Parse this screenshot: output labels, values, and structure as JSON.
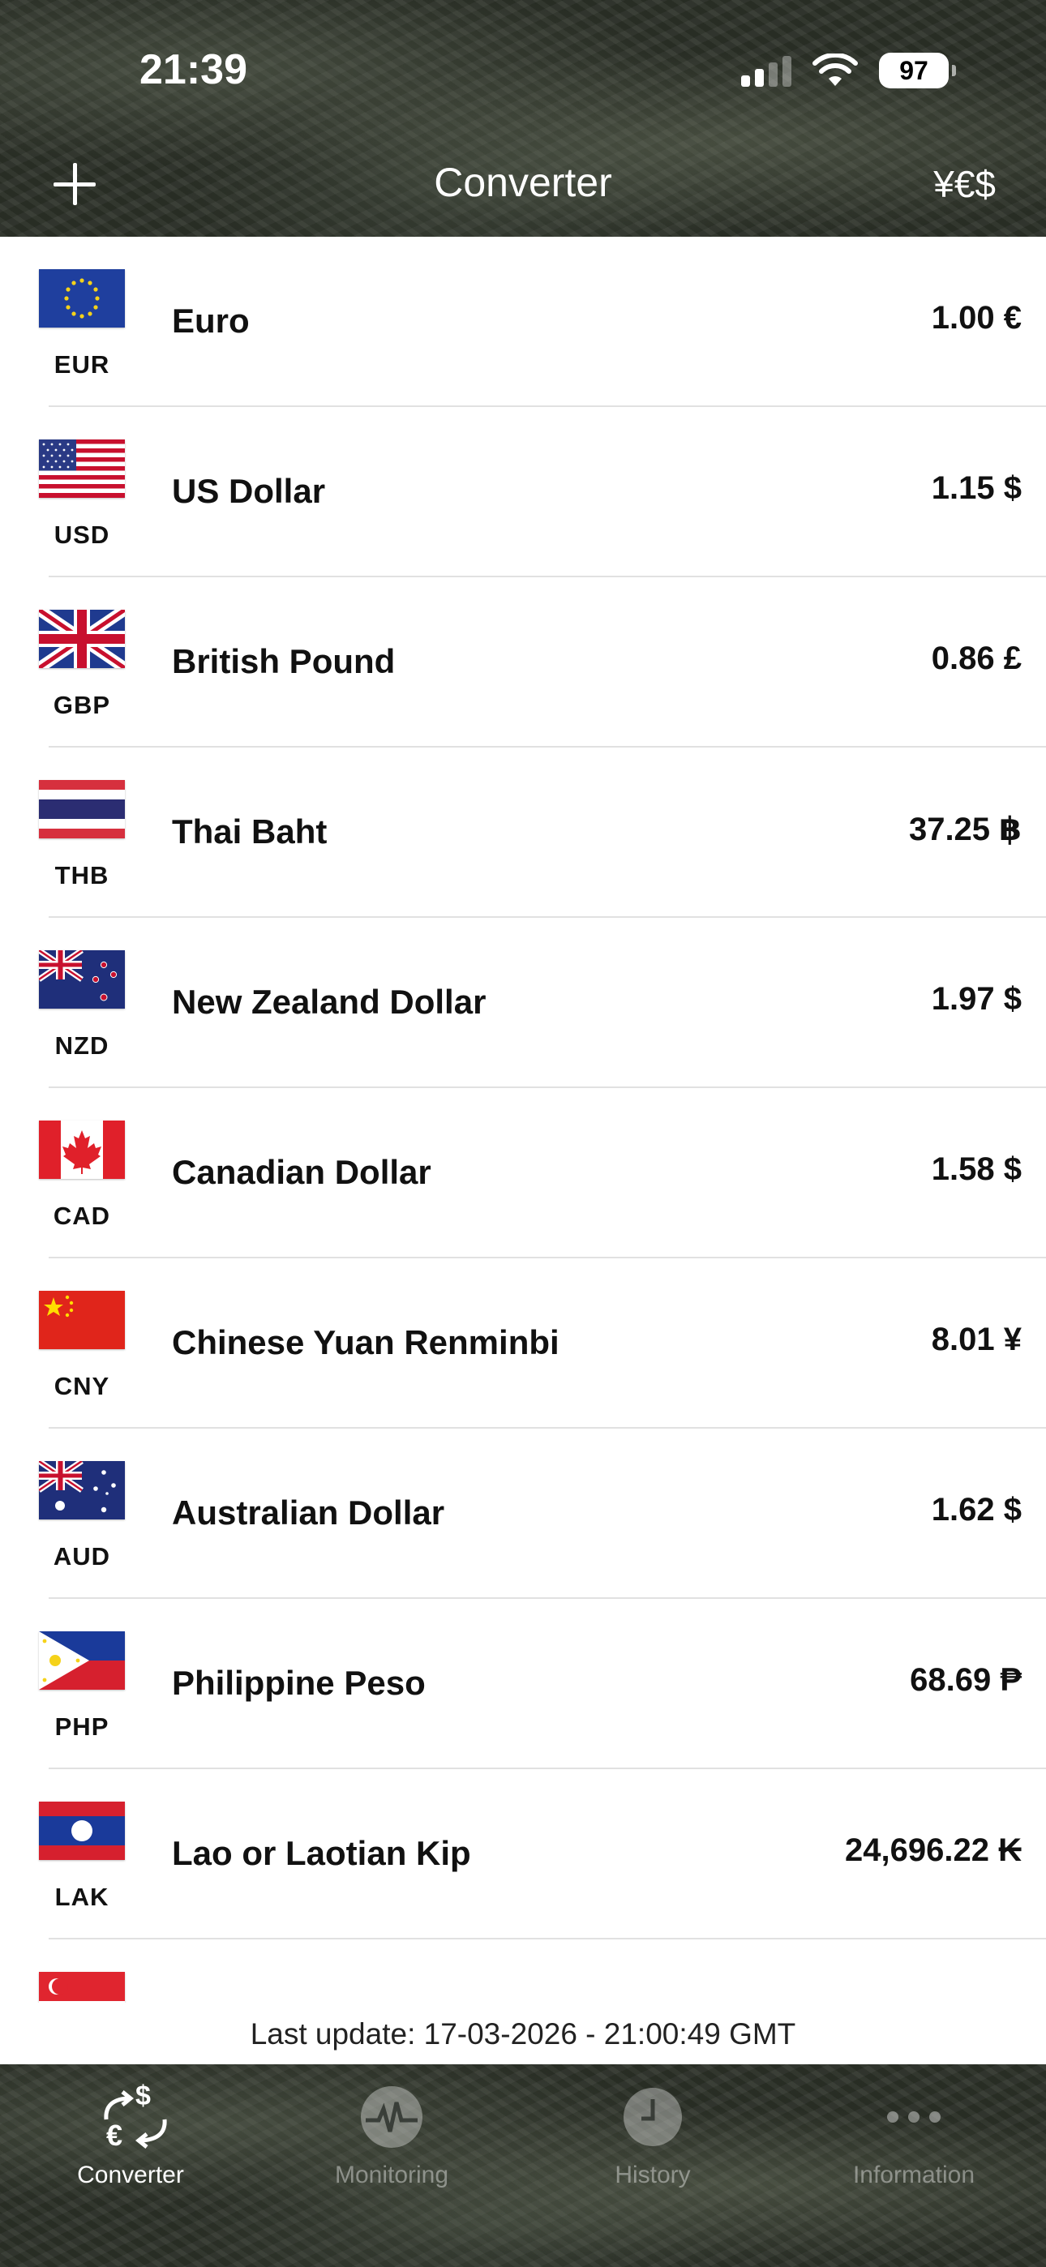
{
  "status_bar": {
    "time": "21:39",
    "battery": "97"
  },
  "nav": {
    "title": "Converter",
    "currency_button": "¥€$"
  },
  "currencies": [
    {
      "code": "EUR",
      "name": "Euro",
      "value": "1.00 €"
    },
    {
      "code": "USD",
      "name": "US Dollar",
      "value": "1.15 $"
    },
    {
      "code": "GBP",
      "name": "British Pound",
      "value": "0.86 £"
    },
    {
      "code": "THB",
      "name": "Thai Baht",
      "value": "37.25 ฿"
    },
    {
      "code": "NZD",
      "name": "New Zealand Dollar",
      "value": "1.97 $"
    },
    {
      "code": "CAD",
      "name": "Canadian Dollar",
      "value": "1.58 $"
    },
    {
      "code": "CNY",
      "name": "Chinese Yuan Renminbi",
      "value": "8.01 ¥"
    },
    {
      "code": "AUD",
      "name": "Australian Dollar",
      "value": "1.62 $"
    },
    {
      "code": "PHP",
      "name": "Philippine Peso",
      "value": "68.69 ₱"
    },
    {
      "code": "LAK",
      "name": "Lao or Laotian Kip",
      "value": "24,696.22 ₭"
    }
  ],
  "footer": {
    "last_update": "Last update: 17-03-2026 - 21:00:49  GMT"
  },
  "tabs": [
    {
      "label": "Converter",
      "icon": "converter-icon",
      "active": true
    },
    {
      "label": "Monitoring",
      "icon": "monitoring-icon",
      "active": false
    },
    {
      "label": "History",
      "icon": "history-icon",
      "active": false
    },
    {
      "label": "Information",
      "icon": "more-icon",
      "active": false
    }
  ]
}
